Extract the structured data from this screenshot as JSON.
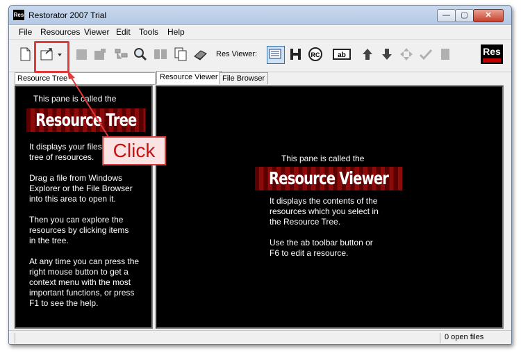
{
  "window": {
    "title": "Restorator 2007 Trial",
    "app_icon_text": "Res"
  },
  "window_controls": {
    "minimize": "—",
    "maximize": "▢",
    "close": "✕"
  },
  "menubar": {
    "items": [
      "File",
      "Resources",
      "Viewer",
      "Edit",
      "Tools",
      "Help"
    ]
  },
  "toolbar": {
    "res_viewer_label": "Res Viewer:",
    "logo_text": "Res"
  },
  "tabs": {
    "left_header": "Resource Tree",
    "right": [
      "Resource Viewer",
      "File Browser"
    ]
  },
  "left_pane": {
    "intro": "This pane is called the",
    "banner": "Resource Tree",
    "p1": "It displays your files\ntree of resources.",
    "p2": "Drag a file from Windows\nExplorer or the File Browser\ninto this area to open it.",
    "p3": "Then you can explore the\nresources by clicking items\nin the tree.",
    "p4": "At any time you can press the\nright mouse button to get a\ncontext menu with the most\nimportant functions, or press\nF1 to see the help."
  },
  "right_pane": {
    "intro": "This pane is called the",
    "banner": "Resource Viewer",
    "p1": "It displays the contents of the\nresources which you select in\nthe Resource Tree.",
    "p2": "Use the ab toolbar button or\nF6 to edit a resource."
  },
  "statusbar": {
    "open_files": "0 open files"
  },
  "annotation": {
    "callout_text": "Click",
    "color": "#e03a3a"
  }
}
